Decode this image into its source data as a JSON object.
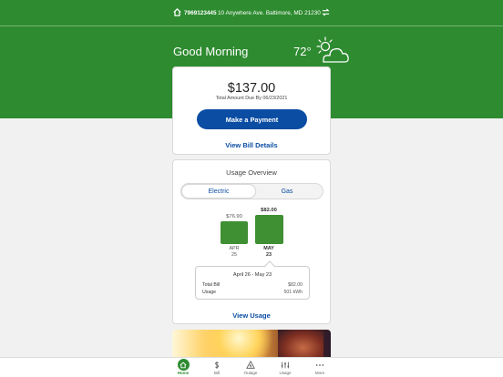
{
  "topbar": {
    "account_number": "7969123445",
    "address": "10 Anywhere Ave. Baltimore, MD 21230"
  },
  "hero": {
    "greeting": "Good Morning",
    "temperature": "72°",
    "weather_icon": "partly-sunny-icon"
  },
  "bill": {
    "amount": "$137.00",
    "due_text": "Total Amount Due By 06/23/2021",
    "pay_button": "Make a Payment",
    "details_link": "View Bill Details"
  },
  "usage": {
    "title": "Usage Overview",
    "tabs": [
      {
        "label": "Electric",
        "active": true
      },
      {
        "label": "Gas",
        "active": false
      }
    ],
    "bars": [
      {
        "month": "APR",
        "day": "25",
        "value_label": "$76.90",
        "value": 76.9
      },
      {
        "month": "MAY",
        "day": "23",
        "value_label": "$82.00",
        "value": 82.0
      }
    ],
    "tooltip": {
      "period": "April 26 - May 23",
      "total_bill_label": "Total Bill",
      "total_bill_value": "$82.00",
      "usage_label": "Usage",
      "usage_value": "501 kWh"
    },
    "view_usage_link": "View Usage"
  },
  "tabbar": {
    "items": [
      {
        "label": "Home",
        "icon": "home-icon",
        "active": true
      },
      {
        "label": "Bill",
        "icon": "dollar-icon",
        "active": false
      },
      {
        "label": "Outage",
        "icon": "outage-icon",
        "active": false
      },
      {
        "label": "Usage",
        "icon": "usage-icon",
        "active": false
      },
      {
        "label": "More",
        "icon": "more-icon",
        "active": false
      }
    ]
  },
  "colors": {
    "brand_green": "#2e8b30",
    "accent_blue": "#0a4da3",
    "bar_green": "#3f8f33"
  }
}
